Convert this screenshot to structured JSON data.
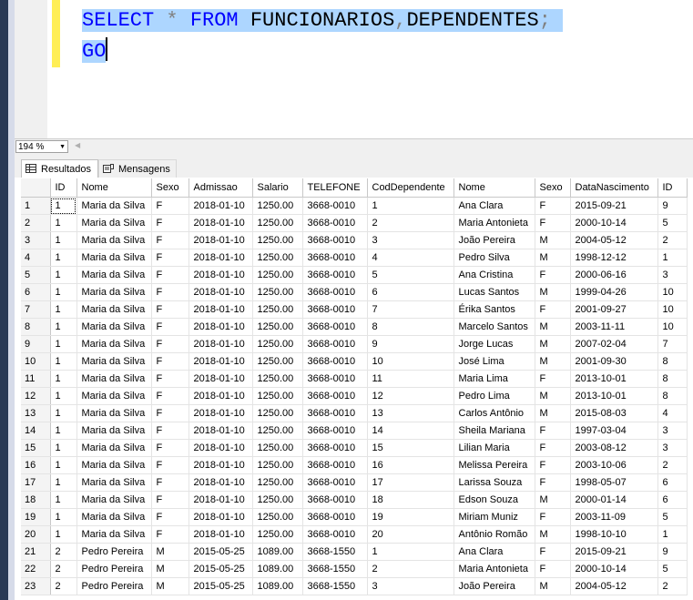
{
  "editor": {
    "line1": {
      "kw1": "SELECT",
      "star": "*",
      "kw2": "FROM",
      "t1": "FUNCIONARIOS",
      "comma": ",",
      "t2": "DEPENDENTES",
      "semi": ";"
    },
    "line2": {
      "go": "GO"
    }
  },
  "statusbar": {
    "zoom": "194 %"
  },
  "tabs": {
    "results": "Resultados",
    "messages": "Mensagens"
  },
  "colors": {
    "keyword": "#0000ff",
    "selection": "#add6ff",
    "change_bar": "#ffee55"
  },
  "grid": {
    "columns": [
      "",
      "ID",
      "Nome",
      "Sexo",
      "Admissao",
      "Salario",
      "TELEFONE",
      "CodDependente",
      "Nome",
      "Sexo",
      "DataNascimento",
      "ID"
    ],
    "rows": [
      [
        "1",
        "1",
        "Maria da Silva",
        "F",
        "2018-01-10",
        "1250.00",
        "3668-0010",
        "1",
        "Ana Clara",
        "F",
        "2015-09-21",
        "9"
      ],
      [
        "2",
        "1",
        "Maria da Silva",
        "F",
        "2018-01-10",
        "1250.00",
        "3668-0010",
        "2",
        "Maria Antonieta",
        "F",
        "2000-10-14",
        "5"
      ],
      [
        "3",
        "1",
        "Maria da Silva",
        "F",
        "2018-01-10",
        "1250.00",
        "3668-0010",
        "3",
        "João Pereira",
        "M",
        "2004-05-12",
        "2"
      ],
      [
        "4",
        "1",
        "Maria da Silva",
        "F",
        "2018-01-10",
        "1250.00",
        "3668-0010",
        "4",
        "Pedro Silva",
        "M",
        "1998-12-12",
        "1"
      ],
      [
        "5",
        "1",
        "Maria da Silva",
        "F",
        "2018-01-10",
        "1250.00",
        "3668-0010",
        "5",
        "Ana Cristina",
        "F",
        "2000-06-16",
        "3"
      ],
      [
        "6",
        "1",
        "Maria da Silva",
        "F",
        "2018-01-10",
        "1250.00",
        "3668-0010",
        "6",
        "Lucas Santos",
        "M",
        "1999-04-26",
        "10"
      ],
      [
        "7",
        "1",
        "Maria da Silva",
        "F",
        "2018-01-10",
        "1250.00",
        "3668-0010",
        "7",
        "Érika Santos",
        "F",
        "2001-09-27",
        "10"
      ],
      [
        "8",
        "1",
        "Maria da Silva",
        "F",
        "2018-01-10",
        "1250.00",
        "3668-0010",
        "8",
        "Marcelo Santos",
        "M",
        "2003-11-11",
        "10"
      ],
      [
        "9",
        "1",
        "Maria da Silva",
        "F",
        "2018-01-10",
        "1250.00",
        "3668-0010",
        "9",
        "Jorge Lucas",
        "M",
        "2007-02-04",
        "7"
      ],
      [
        "10",
        "1",
        "Maria da Silva",
        "F",
        "2018-01-10",
        "1250.00",
        "3668-0010",
        "10",
        "José Lima",
        "M",
        "2001-09-30",
        "8"
      ],
      [
        "11",
        "1",
        "Maria da Silva",
        "F",
        "2018-01-10",
        "1250.00",
        "3668-0010",
        "11",
        "Maria Lima",
        "F",
        "2013-10-01",
        "8"
      ],
      [
        "12",
        "1",
        "Maria da Silva",
        "F",
        "2018-01-10",
        "1250.00",
        "3668-0010",
        "12",
        "Pedro Lima",
        "M",
        "2013-10-01",
        "8"
      ],
      [
        "13",
        "1",
        "Maria da Silva",
        "F",
        "2018-01-10",
        "1250.00",
        "3668-0010",
        "13",
        "Carlos Antônio",
        "M",
        "2015-08-03",
        "4"
      ],
      [
        "14",
        "1",
        "Maria da Silva",
        "F",
        "2018-01-10",
        "1250.00",
        "3668-0010",
        "14",
        "Sheila Mariana",
        "F",
        "1997-03-04",
        "3"
      ],
      [
        "15",
        "1",
        "Maria da Silva",
        "F",
        "2018-01-10",
        "1250.00",
        "3668-0010",
        "15",
        "Lilian Maria",
        "F",
        "2003-08-12",
        "3"
      ],
      [
        "16",
        "1",
        "Maria da Silva",
        "F",
        "2018-01-10",
        "1250.00",
        "3668-0010",
        "16",
        "Melissa Pereira",
        "F",
        "2003-10-06",
        "2"
      ],
      [
        "17",
        "1",
        "Maria da Silva",
        "F",
        "2018-01-10",
        "1250.00",
        "3668-0010",
        "17",
        "Larissa Souza",
        "F",
        "1998-05-07",
        "6"
      ],
      [
        "18",
        "1",
        "Maria da Silva",
        "F",
        "2018-01-10",
        "1250.00",
        "3668-0010",
        "18",
        "Edson Souza",
        "M",
        "2000-01-14",
        "6"
      ],
      [
        "19",
        "1",
        "Maria da Silva",
        "F",
        "2018-01-10",
        "1250.00",
        "3668-0010",
        "19",
        "Miriam Muniz",
        "F",
        "2003-11-09",
        "5"
      ],
      [
        "20",
        "1",
        "Maria da Silva",
        "F",
        "2018-01-10",
        "1250.00",
        "3668-0010",
        "20",
        "Antônio Romão",
        "M",
        "1998-10-10",
        "1"
      ],
      [
        "21",
        "2",
        "Pedro Pereira",
        "M",
        "2015-05-25",
        "1089.00",
        "3668-1550",
        "1",
        "Ana Clara",
        "F",
        "2015-09-21",
        "9"
      ],
      [
        "22",
        "2",
        "Pedro Pereira",
        "M",
        "2015-05-25",
        "1089.00",
        "3668-1550",
        "2",
        "Maria Antonieta",
        "F",
        "2000-10-14",
        "5"
      ],
      [
        "23",
        "2",
        "Pedro Pereira",
        "M",
        "2015-05-25",
        "1089.00",
        "3668-1550",
        "3",
        "João Pereira",
        "M",
        "2004-05-12",
        "2"
      ]
    ]
  }
}
